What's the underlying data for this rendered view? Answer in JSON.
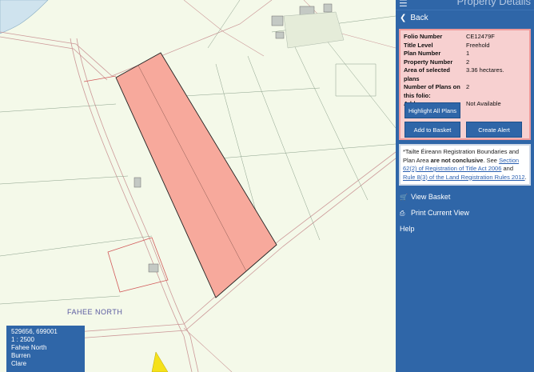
{
  "map": {
    "place_label": "FAHEE NORTH"
  },
  "coords": {
    "xy": "529656, 699001",
    "scale": "1 : 2500",
    "townland": "Fahee North",
    "barony": "Burren",
    "county": "Clare"
  },
  "panel": {
    "title": "Property Details",
    "back_label": "Back",
    "details": [
      {
        "key": "Folio Number",
        "value": "CE12479F"
      },
      {
        "key": "Title Level",
        "value": "Freehold"
      },
      {
        "key": "Plan Number",
        "value": "1"
      },
      {
        "key": "Property Number",
        "value": "2"
      },
      {
        "key": "Area of selected plans",
        "value": "3.36 hectares."
      },
      {
        "key": "Number of Plans on this folio:",
        "value": "2"
      },
      {
        "key": "Address",
        "value": "Not Available"
      }
    ],
    "highlight_label": "Highlight All Plans",
    "add_basket_label": "Add to Basket",
    "create_alert_label": "Create Alert",
    "notice": {
      "part1": "*Tailte Éireann Registration Boundaries and Plan Area ",
      "bold": "are not conclusive",
      "part2": ". See ",
      "link1": "Section 62(2) of Registration of Title Act 2006",
      "part3": " and ",
      "link2": "Rule 8(3) of the Land Registration Rules 2012",
      "part4": "."
    },
    "menu": {
      "view_basket": "View Basket",
      "print_view": "Print Current View",
      "help": "Help"
    }
  },
  "colors": {
    "panel_bg": "#2f66a8",
    "parcel_fill": "#f7a99c",
    "details_bg": "#f7d0d0"
  }
}
